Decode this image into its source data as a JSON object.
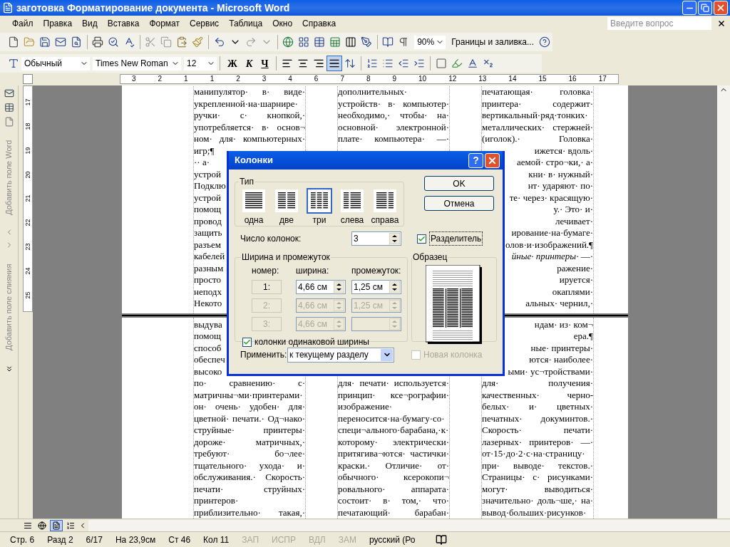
{
  "window": {
    "title": "заготовка Форматирование документа - Microsoft Word"
  },
  "menu": [
    "Файл",
    "Правка",
    "Вид",
    "Вставка",
    "Формат",
    "Сервис",
    "Таблица",
    "Окно",
    "Справка"
  ],
  "ask_box": {
    "placeholder": "Введите вопрос"
  },
  "standard_toolbar": {
    "zoom": "90%",
    "borders_button": "Границы и заливка..."
  },
  "formatting_toolbar": {
    "style": "Обычный",
    "font": "Times New Roman",
    "size": "12",
    "bold": "Ж",
    "italic": "К",
    "underline": "Ч",
    "align_buttons": [
      {
        "kind": "left",
        "selected": false
      },
      {
        "kind": "center",
        "selected": false
      },
      {
        "kind": "right",
        "selected": false
      },
      {
        "kind": "justify",
        "selected": true
      }
    ]
  },
  "ruler": {
    "labels": [
      "3",
      "2",
      "1",
      "1",
      "2",
      "3",
      "4",
      "6",
      "7",
      "8",
      "9",
      "10",
      "12",
      "13",
      "14",
      "15",
      "16",
      "17"
    ]
  },
  "vertical_ruler": {
    "labels": [
      "17",
      "18",
      "19",
      "20",
      "21",
      "22",
      "23",
      "24",
      "25"
    ]
  },
  "side_pane": {
    "top_label": "Добавить поле Word",
    "bottom_label": "Добавить поле слияния"
  },
  "document": {
    "sections": [
      {
        "columns": [
          [
            {
              "kind": "full",
              "lines": [
                "манипулятор· в· виде·",
                "укрепленной·на·шарнире·",
                "ручки· с· кнопкой,·",
                "употребляется· в· основ¬",
                "ном· для· компьютерных·",
                "игр;¶"
              ]
            },
            {
              "kind": "clipped",
              "lines": [
                "·· а·",
                "устрой",
                "Подклю",
                "устрой",
                "помощ",
                "провод",
                "защить",
                "разъем",
                "кабелей",
                "разным",
                "просто",
                "неподх",
                "Некото"
              ]
            }
          ],
          [
            {
              "kind": "full",
              "lines": [
                "дополнительных·",
                "устройств· в· компьютер·",
                "необходимо,· чтобы· на·",
                "основной· электронной·",
                "плате· компьютера· —·"
              ]
            }
          ],
          [
            {
              "kind": "full",
              "lines": [
                "печатающая· головка·",
                "принтера· содержит·",
                "вертикальный·ряд·тонких·",
                "металлических· стержней·",
                "(иголок).· Головка·"
              ]
            },
            {
              "kind": "clipped",
              "lines": [
                "ижется· вдоль·",
                "аемой· стро¬ки,· а·",
                "кни· в· нужный·",
                "нт· ударяют· по·",
                "те· через· красящую·",
                "у.· Это· и·",
                "лечивает·",
                "ирование·на·бумаге·",
                "олов·и·изображений.¶",
                "*йные· принтеры·* —·",
                "ражение·",
                "ируется·",
                "окаплями·",
                "альных· чернил,·"
              ]
            }
          ]
        ]
      },
      {
        "columns": [
          [
            {
              "kind": "clipped",
              "lines": [
                "выдува",
                "помощ",
                "способ",
                "обеспеч",
                "высоко"
              ]
            },
            {
              "kind": "full",
              "lines": [
                "по· сравнению· с·",
                "матричны¬ми·принтерами·",
                "он· очень· удобен· для·",
                "цветной· печати.· Од¬нако·",
                "струйные· принтеры·",
                "дороже· матричных,·",
                "требуют· бо¬лее·",
                "тщательного· ухода· и·",
                "обслуживания.· Скорость·",
                "печати· струйных·",
                "принтеров·",
                "приблизительно· такая,·"
              ]
            }
          ],
          [
            {
              "kind": "full",
              "lines": [
                "для· печати· используется·",
                "принцип· ксе¬рографии·",
                "изображение·",
                "переносится·на·бумагу·со·",
                "специ¬ального·барабана,·к·",
                "которому· электрически·",
                "притягива¬ются· частички·",
                "краски.· Отличие· от·",
                "обычного· ксерокопи¬",
                "ровального· аппарата·",
                "состоит· в· том,· что·",
                "печатающий· барабан·"
              ]
            }
          ],
          [
            {
              "kind": "clipped",
              "lines": [
                "ндам· из· ком¬",
                "ера.¶",
                "ные· принтеры·",
                "ются· наиболее·",
                "ыми· ус¬тройствами·"
              ]
            },
            {
              "kind": "full",
              "lines": [
                "для· получения·",
                "качественных· черно-",
                "белых· и· цветных·",
                "печатных· докуминтов.·",
                "Скорость· печати·",
                "лазерных· принтеров· —·",
                "от·15·до·2·с·на·страницу·",
                "при· выводе· текстов.·",
                "Страницы· с· рисунками·",
                "могут· выводиться·",
                "значительно· доль¬ше,· на·",
                "вывод·больших·рисунков·"
              ]
            }
          ]
        ]
      }
    ]
  },
  "dialog": {
    "title": "Колонки",
    "help": "?",
    "type_group": {
      "label": "Тип",
      "presets": [
        {
          "kind": "one",
          "label": "одна",
          "selected": false
        },
        {
          "kind": "two",
          "label": "две",
          "selected": false
        },
        {
          "kind": "three",
          "label": "три",
          "selected": true
        },
        {
          "kind": "left",
          "label": "слева",
          "selected": false
        },
        {
          "kind": "right",
          "label": "справа",
          "selected": false
        }
      ]
    },
    "ok": "OK",
    "cancel": "Отмена",
    "count": {
      "label": "Число колонок:",
      "value": "3"
    },
    "separator": {
      "label": "Разделитель",
      "checked": true
    },
    "width_group": {
      "label": "Ширина и промежуток",
      "headers": [
        "номер:",
        "ширина:",
        "промежуток:"
      ],
      "rows": [
        {
          "number": "1:",
          "width": "4,66 см",
          "spacing": "1,25 см",
          "disabled": false
        },
        {
          "number": "2:",
          "width": "4,66 см",
          "spacing": "1,25 см",
          "disabled": true
        },
        {
          "number": "3:",
          "width": "4,66 см",
          "disabled": true
        }
      ]
    },
    "equal_width": {
      "label": "колонки одинаковой ширины",
      "checked": true
    },
    "preview": {
      "label": "Образец"
    },
    "apply": {
      "label": "Применить:",
      "value": "к текущему разделу"
    },
    "new_column": {
      "label": "Новая колонка",
      "checked": false,
      "disabled": true
    }
  },
  "view_buttons": [
    {
      "kind": "normal",
      "selected": false
    },
    {
      "kind": "web",
      "selected": false
    },
    {
      "kind": "print",
      "selected": true
    },
    {
      "kind": "outline",
      "selected": false
    }
  ],
  "status_bar": [
    {
      "text": "Стр. 6",
      "disabled": false
    },
    {
      "text": "Разд 2",
      "disabled": false
    },
    {
      "text": "6/17",
      "disabled": false
    },
    {
      "text": "На 23,9см",
      "disabled": false
    },
    {
      "text": "Ст 46",
      "disabled": false
    },
    {
      "text": "Кол 11",
      "disabled": false
    },
    {
      "text": "ЗАП",
      "disabled": true
    },
    {
      "text": "ИСПР",
      "disabled": true
    },
    {
      "text": "ВДЛ",
      "disabled": true
    },
    {
      "text": "ЗАМ",
      "disabled": true
    },
    {
      "text": "русский (Ро",
      "disabled": false
    }
  ]
}
